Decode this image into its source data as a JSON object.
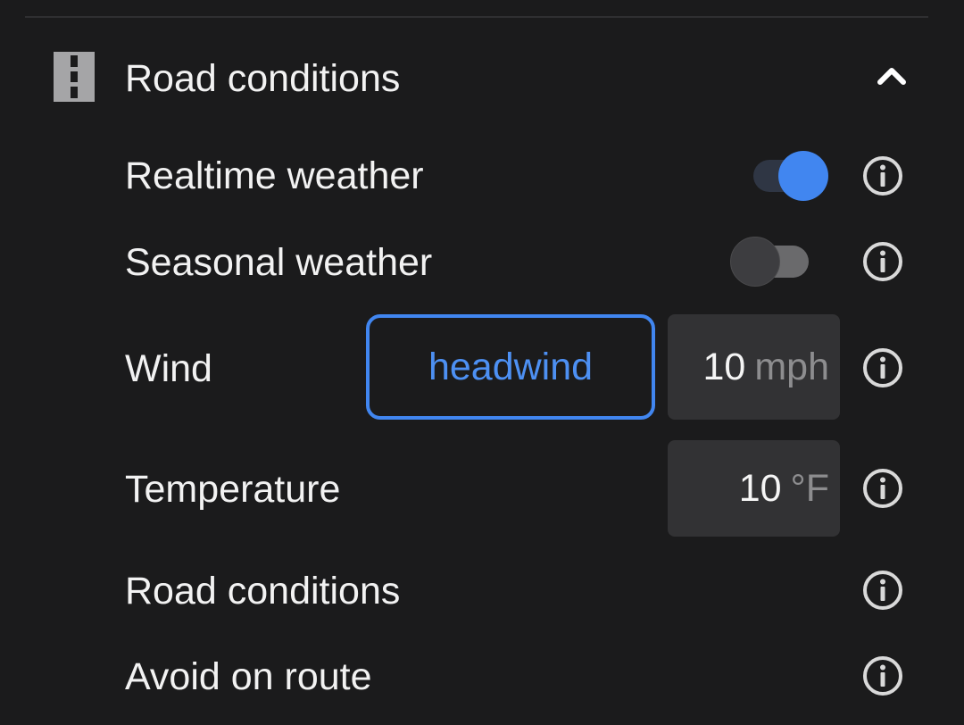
{
  "section": {
    "title": "Road conditions",
    "icon": "road-icon",
    "collapse_icon": "chevron-up-icon"
  },
  "rows": {
    "realtime": {
      "label": "Realtime weather",
      "toggle_on": true
    },
    "seasonal": {
      "label": "Seasonal weather",
      "toggle_on": false
    },
    "wind": {
      "label": "Wind",
      "direction": "headwind",
      "value": "10",
      "unit": "mph"
    },
    "temperature": {
      "label": "Temperature",
      "value": "10",
      "unit": "°F"
    },
    "road_conditions": {
      "label": "Road conditions"
    },
    "avoid": {
      "label": "Avoid on route"
    }
  },
  "colors": {
    "background": "#1b1b1c",
    "accent": "#4186f0",
    "input_bg": "#323234",
    "unit_text": "#8d8d8f"
  },
  "info_icon": "info-icon"
}
